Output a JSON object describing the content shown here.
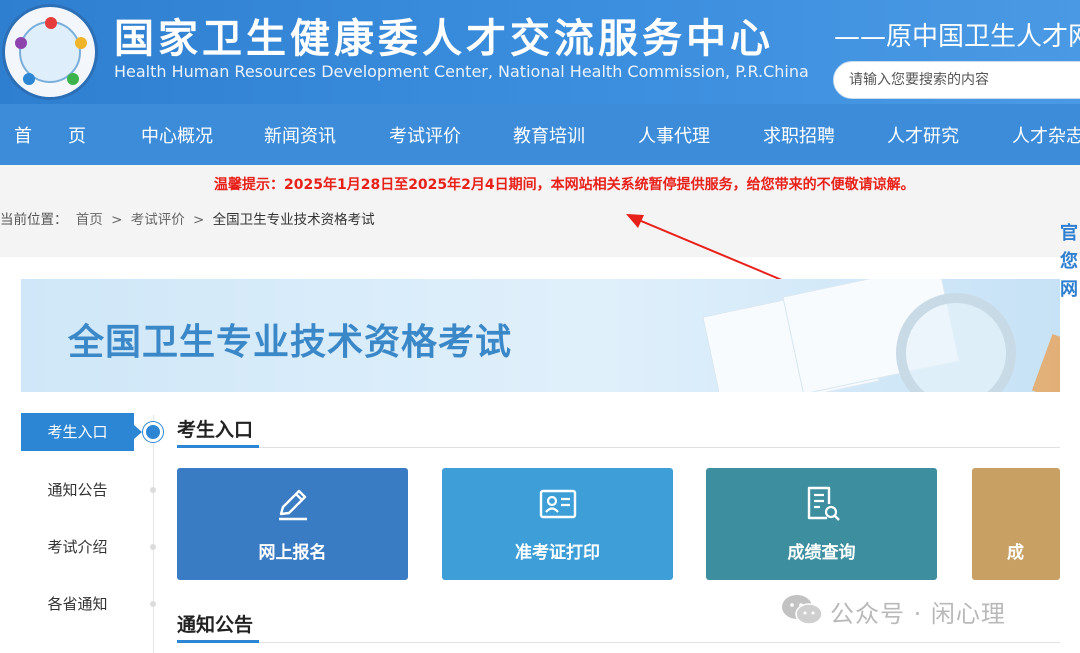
{
  "header": {
    "title": "国家卫生健康委人才交流服务中心",
    "subtitle": "Health Human Resources Development Center, National Health Commission, P.R.China",
    "former_name": "——原中国卫生人才网",
    "search_placeholder": "请输入您要搜索的内容"
  },
  "nav": {
    "items": [
      "首　　页",
      "中心概况",
      "新闻资讯",
      "考试评价",
      "教育培训",
      "人事代理",
      "求职招聘",
      "人才研究",
      "人才杂志"
    ]
  },
  "notice": {
    "warm_tip": "温馨提示：2025年1月28日至2025年2月4日期间，本网站相关系统暂停提供服务，给您带来的不便敬请谅解。"
  },
  "breadcrumb": {
    "prefix": "当前位置：",
    "items": [
      "首页",
      "考试评价",
      "全国卫生专业技术资格考试"
    ],
    "separator": ">"
  },
  "side_tips": [
    "官",
    "您",
    "网"
  ],
  "banner": {
    "title": "全国卫生专业技术资格考试"
  },
  "sidebar": {
    "items": [
      "考生入口",
      "通知公告",
      "考试介绍",
      "各省通知"
    ],
    "active_index": 0
  },
  "main": {
    "section1_title": "考生入口",
    "section2_title": "通知公告",
    "cards": [
      {
        "label": "网上报名",
        "icon": "pencil-icon",
        "color": "#3a7cc4"
      },
      {
        "label": "准考证打印",
        "icon": "id-card-icon",
        "color": "#3e9fd8"
      },
      {
        "label": "成绩查询",
        "icon": "document-search-icon",
        "color": "#3d8e9e"
      },
      {
        "label": "成",
        "icon": "",
        "color": "#c8a063"
      }
    ]
  },
  "watermark": {
    "text": "公众号 · 闲心理"
  },
  "colors": {
    "header_blue": "#2f7fd0",
    "nav_blue": "#3d8cd9",
    "alert_red": "#e8201a",
    "active_blue": "#2c86d4"
  }
}
